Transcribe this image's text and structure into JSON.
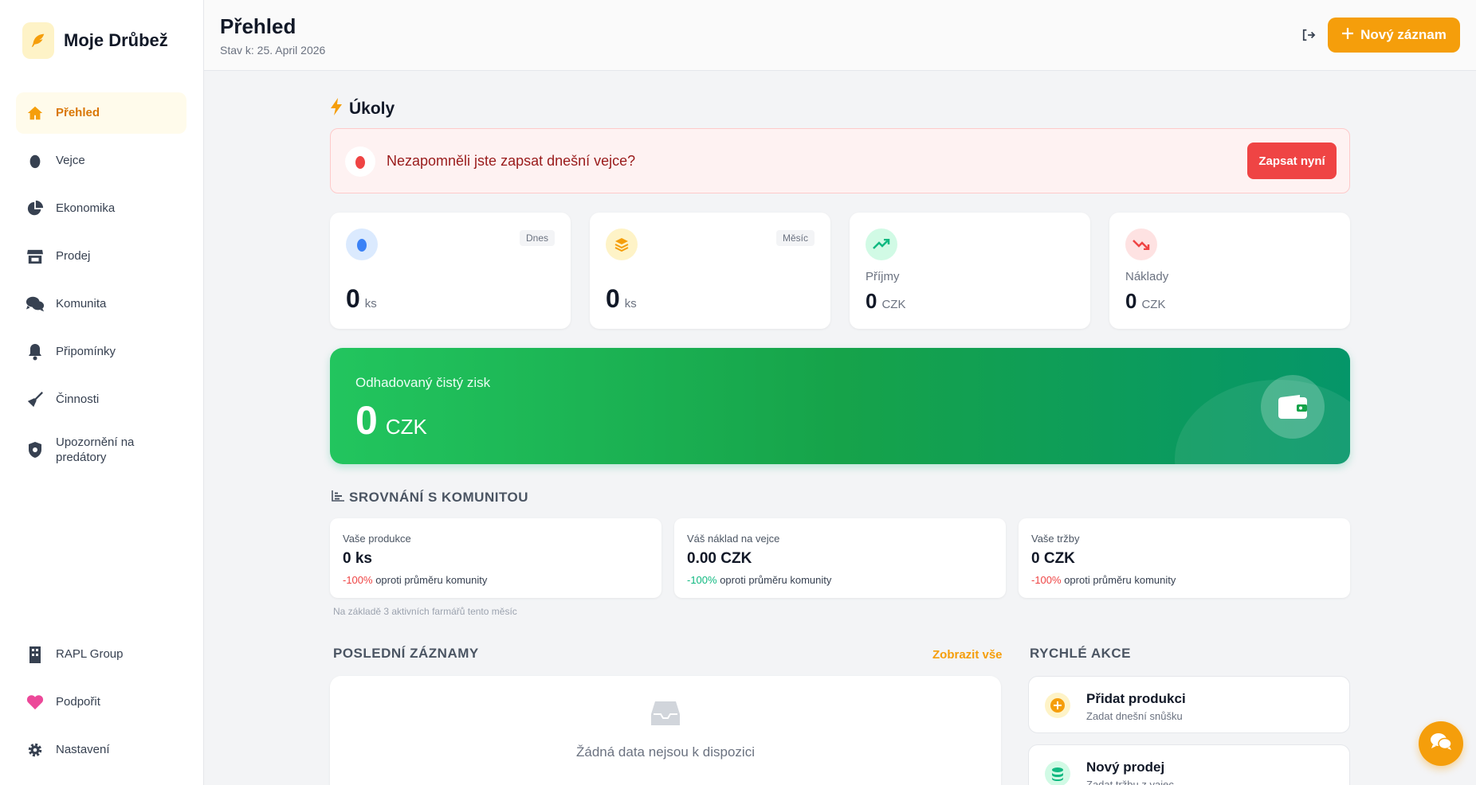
{
  "app": {
    "name": "Moje Drůbež"
  },
  "sidebar": {
    "items": [
      {
        "label": "Přehled",
        "icon": "home-icon",
        "active": true
      },
      {
        "label": "Vejce",
        "icon": "egg-icon"
      },
      {
        "label": "Ekonomika",
        "icon": "pie-chart-icon"
      },
      {
        "label": "Prodej",
        "icon": "store-icon"
      },
      {
        "label": "Komunita",
        "icon": "comments-icon"
      },
      {
        "label": "Připomínky",
        "icon": "bell-icon"
      },
      {
        "label": "Činnosti",
        "icon": "broom-icon"
      },
      {
        "label": "Upozornění na predátory",
        "icon": "shield-icon"
      }
    ],
    "bottom": [
      {
        "label": "RAPL Group",
        "icon": "building-icon"
      },
      {
        "label": "Podpořit",
        "icon": "heart-icon"
      },
      {
        "label": "Nastavení",
        "icon": "gear-icon"
      }
    ]
  },
  "header": {
    "title": "Přehled",
    "subtitle": "Stav k: 25. April 2026",
    "new_button": "Nový záznam"
  },
  "tasks": {
    "title": "Úkoly",
    "alert_text": "Nezapomněli jste zapsat dnešní vejce?",
    "alert_button": "Zapsat nyní"
  },
  "stats": [
    {
      "badge": "Dnes",
      "value": "0",
      "unit": "ks",
      "icon": "egg-icon"
    },
    {
      "badge": "Měsíc",
      "value": "0",
      "unit": "ks",
      "icon": "layers-icon"
    },
    {
      "label": "Příjmy",
      "value": "0",
      "unit": "CZK",
      "icon": "trend-up-icon"
    },
    {
      "label": "Náklady",
      "value": "0",
      "unit": "CZK",
      "icon": "trend-down-icon"
    }
  ],
  "profit": {
    "label": "Odhadovaný čistý zisk",
    "value": "0",
    "unit": "CZK"
  },
  "comparison": {
    "title": "SROVNÁNÍ S KOMUNITOU",
    "cards": [
      {
        "label": "Vaše produkce",
        "value": "0 ks",
        "pct": "-100%",
        "note": " oproti průměru komunity"
      },
      {
        "label": "Váš náklad na vejce",
        "value": "0.00 CZK",
        "pct": "-100%",
        "note": " oproti průměru komunity"
      },
      {
        "label": "Vaše tržby",
        "value": "0 CZK",
        "pct": "-100%",
        "note": " oproti průměru komunity"
      }
    ],
    "footnote": "Na základě 3 aktivních farmářů tento měsíc"
  },
  "recent": {
    "title": "POSLEDNÍ ZÁZNAMY",
    "link": "Zobrazit vše",
    "empty": "Žádná data nejsou k dispozici"
  },
  "quick": {
    "title": "RYCHLÉ AKCE",
    "items": [
      {
        "name": "Přidat produkci",
        "sub": "Zadat dnešní snůšku"
      },
      {
        "name": "Nový prodej",
        "sub": "Zadat tržbu z vajec"
      }
    ]
  },
  "colors": {
    "accent": "#f59e0b",
    "danger": "#ef4444",
    "success": "#10b981"
  }
}
